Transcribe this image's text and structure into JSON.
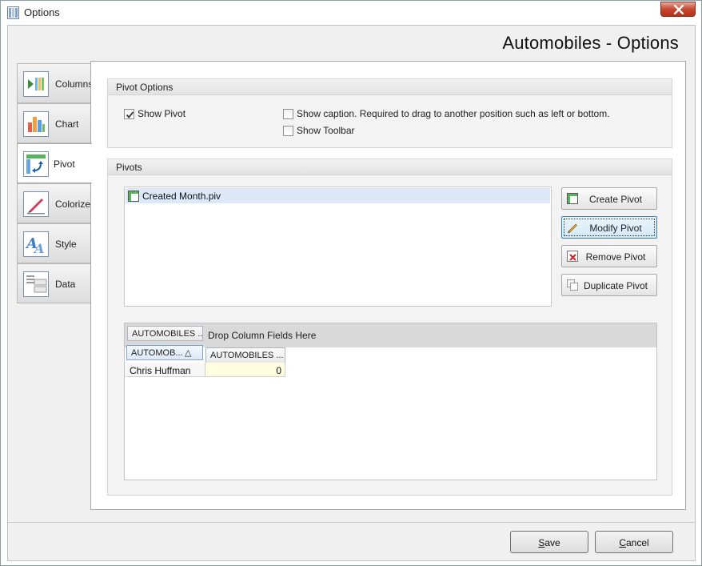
{
  "window": {
    "title": "Options"
  },
  "header": {
    "title": "Automobiles - Options"
  },
  "sidebar": {
    "items": [
      {
        "label": "Columns",
        "icon": "columns-icon"
      },
      {
        "label": "Chart",
        "icon": "bar-chart-icon"
      },
      {
        "label": "Pivot",
        "icon": "pivot-icon",
        "active": true
      },
      {
        "label": "Colorize",
        "icon": "colorize-pen-icon"
      },
      {
        "label": "Style",
        "icon": "font-style-icon"
      },
      {
        "label": "Data",
        "icon": "data-table-icon"
      }
    ]
  },
  "pivot_options": {
    "header": "Pivot Options",
    "show_pivot": {
      "label": "Show Pivot",
      "checked": true
    },
    "show_caption": {
      "label": "Show caption. Required to drag to another position such as left or bottom.",
      "checked": false
    },
    "show_toolbar": {
      "label": "Show Toolbar",
      "checked": false
    }
  },
  "pivots": {
    "header": "Pivots",
    "list": [
      {
        "label": "Created Month.piv",
        "icon": "pivot-file-icon",
        "selected": true
      }
    ],
    "buttons": {
      "create": "Create Pivot",
      "modify": "Modify Pivot",
      "remove": "Remove Pivot",
      "duplicate": "Duplicate Pivot"
    }
  },
  "pivot_grid": {
    "filter_field": "AUTOMOBILES ...",
    "drop_hint": "Drop Column Fields Here",
    "row_field": "AUTOMOB...",
    "sort_glyph": "△",
    "data_field": "AUTOMOBILES ...",
    "rows": [
      {
        "label": "Chris Huffman",
        "value": "0"
      }
    ]
  },
  "footer": {
    "save_pre": "",
    "save_key": "S",
    "save_post": "ave",
    "cancel_pre": "",
    "cancel_key": "C",
    "cancel_post": "ancel"
  },
  "colors": {
    "accent": "#3c7fb1",
    "selection": "#dce8f8",
    "value_cell": "#fffde0",
    "close": "#c7462f"
  }
}
